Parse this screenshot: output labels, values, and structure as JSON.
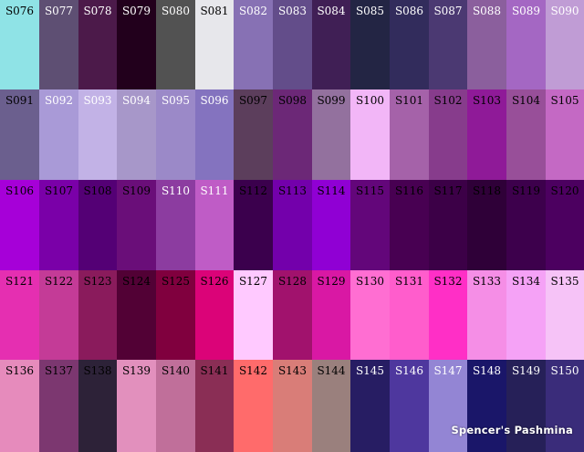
{
  "brand": "Spencer's Pashmina",
  "swatches": [
    {
      "code": "S076",
      "color": "#8fe3e6",
      "text_color": "#000000"
    },
    {
      "code": "S077",
      "color": "#5e4f73",
      "text_color": "#ffffff"
    },
    {
      "code": "S078",
      "color": "#4c1a4a",
      "text_color": "#ffffff"
    },
    {
      "code": "S079",
      "color": "#22001c",
      "text_color": "#ffffff"
    },
    {
      "code": "S080",
      "color": "#525252",
      "text_color": "#ffffff"
    },
    {
      "code": "S081",
      "color": "#e7e7eb",
      "text_color": "#000000"
    },
    {
      "code": "S082",
      "color": "#8771b4",
      "text_color": "#ffffff"
    },
    {
      "code": "S083",
      "color": "#634d8a",
      "text_color": "#ffffff"
    },
    {
      "code": "S084",
      "color": "#401f55",
      "text_color": "#ffffff"
    },
    {
      "code": "S085",
      "color": "#232544",
      "text_color": "#ffffff"
    },
    {
      "code": "S086",
      "color": "#322c5c",
      "text_color": "#ffffff"
    },
    {
      "code": "S087",
      "color": "#4b3972",
      "text_color": "#ffffff"
    },
    {
      "code": "S088",
      "color": "#8b5f9d",
      "text_color": "#ffffff"
    },
    {
      "code": "S089",
      "color": "#a467c3",
      "text_color": "#ffffff"
    },
    {
      "code": "S090",
      "color": "#c09cd5",
      "text_color": "#ffffff"
    },
    {
      "code": "S091",
      "color": "#6b5f8e",
      "text_color": "#000000"
    },
    {
      "code": "S092",
      "color": "#a99ad7",
      "text_color": "#ffffff"
    },
    {
      "code": "S093",
      "color": "#c2b2e6",
      "text_color": "#ffffff"
    },
    {
      "code": "S094",
      "color": "#a797c9",
      "text_color": "#ffffff"
    },
    {
      "code": "S095",
      "color": "#9b89c8",
      "text_color": "#ffffff"
    },
    {
      "code": "S096",
      "color": "#8473bf",
      "text_color": "#ffffff"
    },
    {
      "code": "S097",
      "color": "#5c3e5c",
      "text_color": "#000000"
    },
    {
      "code": "S098",
      "color": "#6c2877",
      "text_color": "#000000"
    },
    {
      "code": "S099",
      "color": "#93719e",
      "text_color": "#000000"
    },
    {
      "code": "S100",
      "color": "#f2b6f7",
      "text_color": "#000000"
    },
    {
      "code": "S101",
      "color": "#a562a9",
      "text_color": "#000000"
    },
    {
      "code": "S102",
      "color": "#873c8c",
      "text_color": "#000000"
    },
    {
      "code": "S103",
      "color": "#8f1a98",
      "text_color": "#000000"
    },
    {
      "code": "S104",
      "color": "#984f99",
      "text_color": "#000000"
    },
    {
      "code": "S105",
      "color": "#c469c4",
      "text_color": "#000000"
    },
    {
      "code": "S106",
      "color": "#a600d8",
      "text_color": "#000000"
    },
    {
      "code": "S107",
      "color": "#7a00a8",
      "text_color": "#000000"
    },
    {
      "code": "S108",
      "color": "#540075",
      "text_color": "#000000"
    },
    {
      "code": "S109",
      "color": "#6a0e79",
      "text_color": "#000000"
    },
    {
      "code": "S110",
      "color": "#8c3ca0",
      "text_color": "#ffffff"
    },
    {
      "code": "S111",
      "color": "#bf5cc6",
      "text_color": "#ffffff"
    },
    {
      "code": "S112",
      "color": "#3b004d",
      "text_color": "#000000"
    },
    {
      "code": "S113",
      "color": "#7300ab",
      "text_color": "#000000"
    },
    {
      "code": "S114",
      "color": "#9000d4",
      "text_color": "#000000"
    },
    {
      "code": "S115",
      "color": "#63067a",
      "text_color": "#000000"
    },
    {
      "code": "S116",
      "color": "#480052",
      "text_color": "#000000"
    },
    {
      "code": "S117",
      "color": "#3c0047",
      "text_color": "#000000"
    },
    {
      "code": "S118",
      "color": "#2f0038",
      "text_color": "#000000"
    },
    {
      "code": "S119",
      "color": "#3d004c",
      "text_color": "#000000"
    },
    {
      "code": "S120",
      "color": "#4c0060",
      "text_color": "#000000"
    },
    {
      "code": "S121",
      "color": "#e52fb1",
      "text_color": "#000000"
    },
    {
      "code": "S122",
      "color": "#c43b97",
      "text_color": "#000000"
    },
    {
      "code": "S123",
      "color": "#8a1b5c",
      "text_color": "#000000"
    },
    {
      "code": "S124",
      "color": "#520135",
      "text_color": "#000000"
    },
    {
      "code": "S125",
      "color": "#80003e",
      "text_color": "#000000"
    },
    {
      "code": "S126",
      "color": "#db0378",
      "text_color": "#000000"
    },
    {
      "code": "S127",
      "color": "#ffc9ff",
      "text_color": "#000000"
    },
    {
      "code": "S128",
      "color": "#a1126d",
      "text_color": "#000000"
    },
    {
      "code": "S129",
      "color": "#d918a4",
      "text_color": "#000000"
    },
    {
      "code": "S130",
      "color": "#ff6ed2",
      "text_color": "#000000"
    },
    {
      "code": "S131",
      "color": "#ff5dcc",
      "text_color": "#000000"
    },
    {
      "code": "S132",
      "color": "#ff2fc6",
      "text_color": "#000000"
    },
    {
      "code": "S133",
      "color": "#f58ee6",
      "text_color": "#000000"
    },
    {
      "code": "S134",
      "color": "#f5a2f6",
      "text_color": "#000000"
    },
    {
      "code": "S135",
      "color": "#f6c3f7",
      "text_color": "#000000"
    },
    {
      "code": "S136",
      "color": "#e68bbc",
      "text_color": "#000000"
    },
    {
      "code": "S137",
      "color": "#7c3770",
      "text_color": "#000000"
    },
    {
      "code": "S138",
      "color": "#2d2238",
      "text_color": "#000000"
    },
    {
      "code": "S139",
      "color": "#e290bd",
      "text_color": "#000000"
    },
    {
      "code": "S140",
      "color": "#c06f9a",
      "text_color": "#000000"
    },
    {
      "code": "S141",
      "color": "#8a2e55",
      "text_color": "#000000"
    },
    {
      "code": "S142",
      "color": "#ff6b6b",
      "text_color": "#000000"
    },
    {
      "code": "S143",
      "color": "#d97d78",
      "text_color": "#000000"
    },
    {
      "code": "S144",
      "color": "#9a807d",
      "text_color": "#000000"
    },
    {
      "code": "S145",
      "color": "#271d63",
      "text_color": "#ffffff"
    },
    {
      "code": "S146",
      "color": "#4e379e",
      "text_color": "#ffffff"
    },
    {
      "code": "S147",
      "color": "#9385d4",
      "text_color": "#ffffff"
    },
    {
      "code": "S148",
      "color": "#1a1669",
      "text_color": "#ffffff"
    },
    {
      "code": "S149",
      "color": "#262058",
      "text_color": "#ffffff"
    },
    {
      "code": "S150",
      "color": "#3a2c7a",
      "text_color": "#ffffff"
    }
  ]
}
